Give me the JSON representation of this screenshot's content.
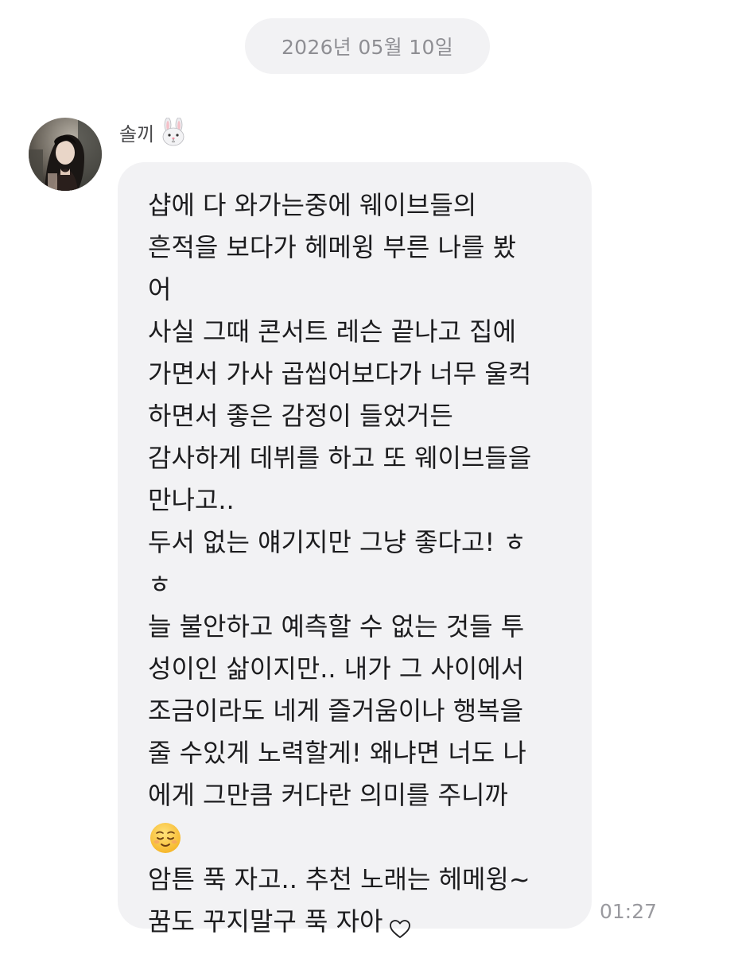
{
  "date_separator": "2026년 05월 10일",
  "sender": {
    "name": "솔끼",
    "name_emoji": "rabbit-face-icon"
  },
  "message": {
    "lines": [
      "샵에 다 와가는중에 웨이브들의",
      "흔적을 보다가 헤메윙 부른 나를 봤",
      "어",
      "사실 그때 콘서트 레슨 끝나고 집에",
      "가면서 가사 곱씹어보다가 너무 울컥",
      "하면서 좋은 감정이 들었거든",
      "감사하게 데뷔를 하고 또 웨이브들을",
      "만나고..",
      "두서 없는 얘기지만 그냥 좋다고! ㅎ",
      "ㅎ",
      "늘 불안하고 예측할 수 없는 것들 투",
      "성이인 삶이지만.. 내가 그 사이에서",
      "조금이라도 네게 즐거움이나 행복을",
      "줄 수있게 노력할게! 왜냐면 너도 나",
      "에게 그만큼 커다란 의미를 주니까"
    ],
    "emoji": "relieved-face-icon",
    "lines_after": [
      "암튼 푹 자고.. 추천 노래는 헤메윙~",
      "꿈도 꾸지말구 푹 자아"
    ],
    "end_icon": "heart-outline-icon",
    "time": "01:27"
  },
  "colors": {
    "bubble": "#f2f2f4",
    "date_pill": "#f2f2f4",
    "text": "#1c1c1e",
    "muted": "#8e8e93"
  }
}
